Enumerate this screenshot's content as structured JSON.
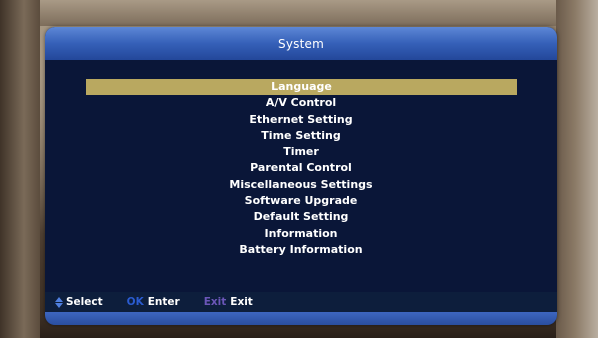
{
  "dialog": {
    "title": "System"
  },
  "menu": {
    "items": [
      {
        "label": "Language",
        "selected": true
      },
      {
        "label": "A/V Control",
        "selected": false
      },
      {
        "label": "Ethernet Setting",
        "selected": false
      },
      {
        "label": "Time Setting",
        "selected": false
      },
      {
        "label": "Timer",
        "selected": false
      },
      {
        "label": "Parental Control",
        "selected": false
      },
      {
        "label": "Miscellaneous Settings",
        "selected": false
      },
      {
        "label": "Software Upgrade",
        "selected": false
      },
      {
        "label": "Default Setting",
        "selected": false
      },
      {
        "label": "Information",
        "selected": false
      },
      {
        "label": "Battery Information",
        "selected": false
      }
    ]
  },
  "footer": {
    "select_label": "Select",
    "ok_key": "OK",
    "enter_label": "Enter",
    "exit_key": "Exit",
    "exit_label": "Exit"
  },
  "colors": {
    "header": "#3560b8",
    "panel": "#0a1638",
    "selection": "#b9a860",
    "ok_key": "#2a5bd0",
    "exit_key": "#6b56b8"
  },
  "icons": {
    "select": "up-down-arrows-icon"
  }
}
